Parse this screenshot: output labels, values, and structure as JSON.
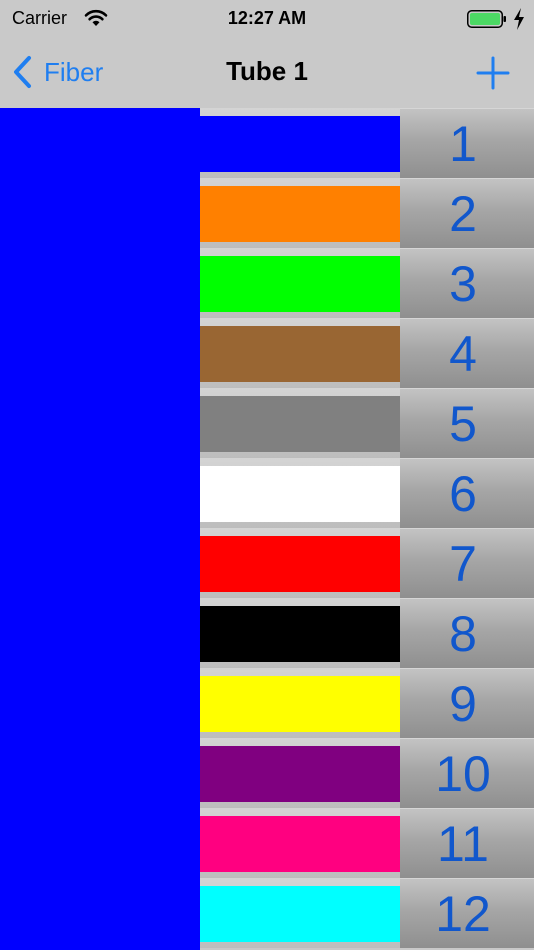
{
  "status_bar": {
    "carrier": "Carrier",
    "time": "12:27 AM",
    "icons": [
      "wifi-icon",
      "battery-icon",
      "charging-bolt-icon"
    ],
    "battery_color": "#4cd964"
  },
  "nav_bar": {
    "back_label": "Fiber",
    "title": "Tube 1",
    "add_icon": "plus-icon",
    "accent_color": "#1f7ef0"
  },
  "tube": {
    "color": "#0000ff"
  },
  "fibers": [
    {
      "number": "1",
      "color": "#0000ff"
    },
    {
      "number": "2",
      "color": "#ff8000"
    },
    {
      "number": "3",
      "color": "#00ff00"
    },
    {
      "number": "4",
      "color": "#996633"
    },
    {
      "number": "5",
      "color": "#808080"
    },
    {
      "number": "6",
      "color": "#ffffff"
    },
    {
      "number": "7",
      "color": "#ff0000"
    },
    {
      "number": "8",
      "color": "#000000"
    },
    {
      "number": "9",
      "color": "#ffff00"
    },
    {
      "number": "10",
      "color": "#800080"
    },
    {
      "number": "11",
      "color": "#ff0080"
    },
    {
      "number": "12",
      "color": "#00ffff"
    }
  ]
}
